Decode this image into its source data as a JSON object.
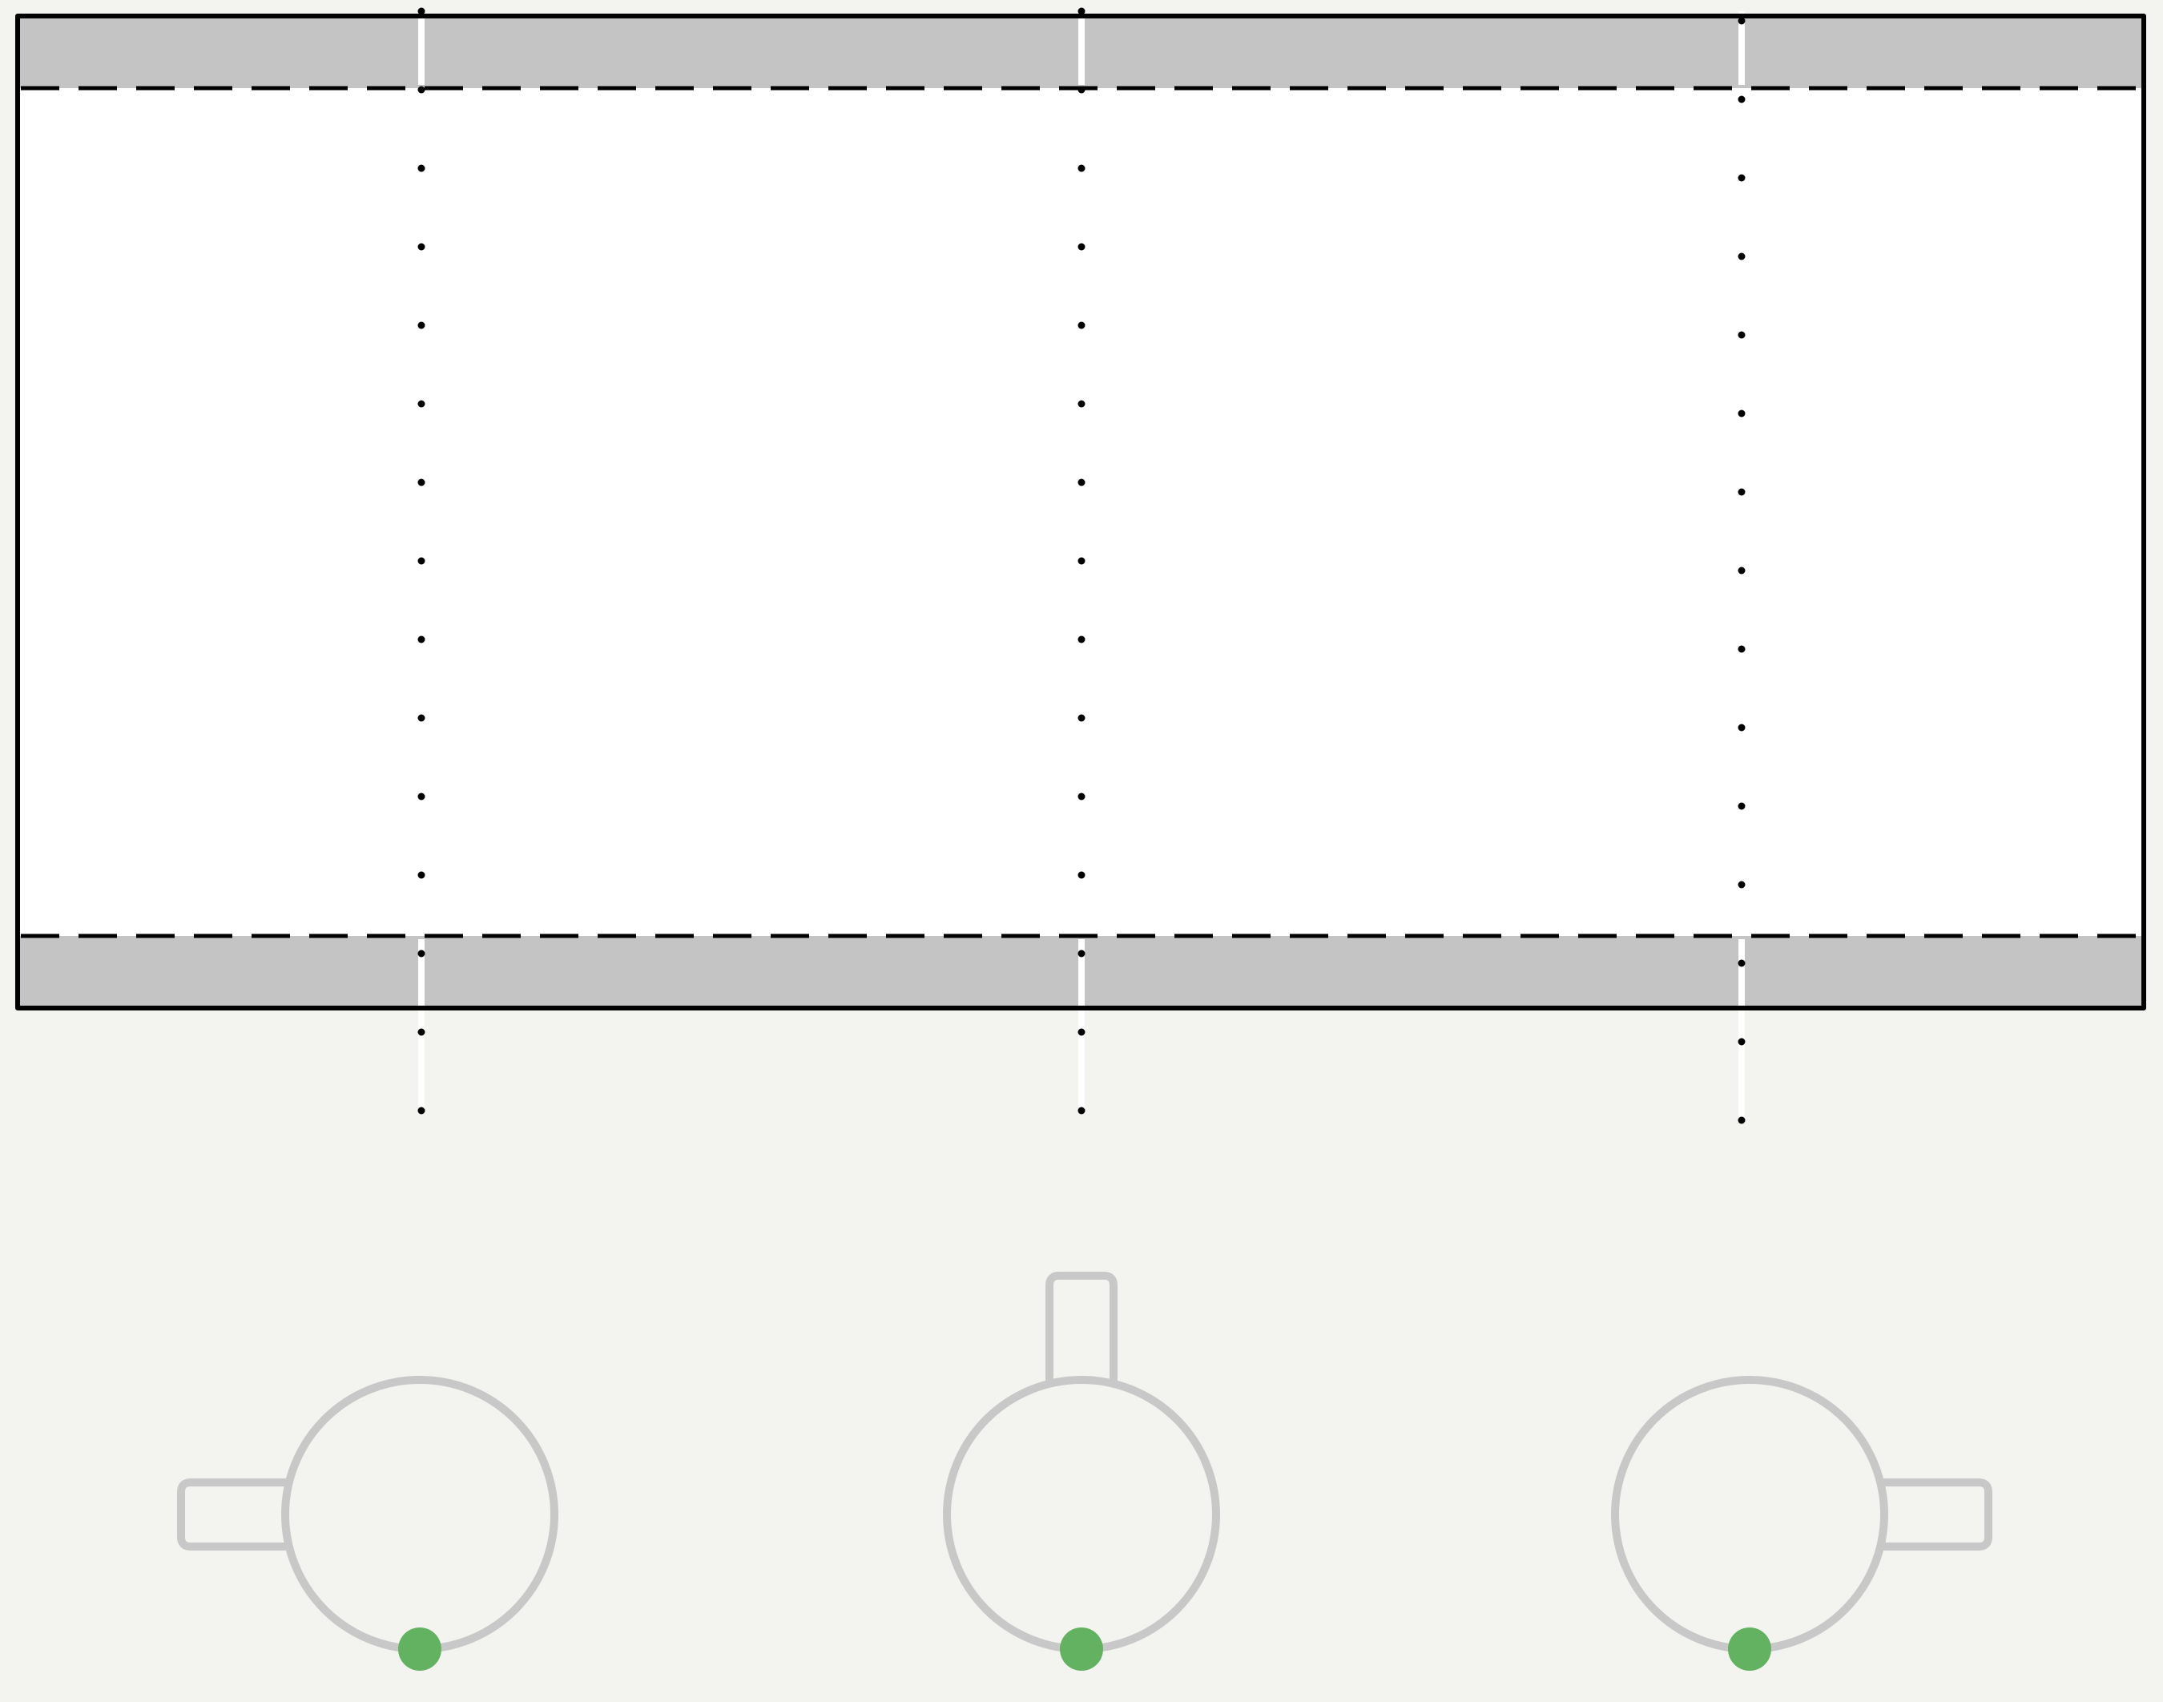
{
  "diagram": {
    "colors": {
      "background": "#f3f4ef",
      "panel_fill": "#ffffff",
      "band_fill": "#c4c4c4",
      "outline": "#000000",
      "divider": "#ffffff",
      "dot": "#000000",
      "knob_outline": "#c8c8c8",
      "indicator": "#62b262"
    },
    "panel": {
      "top_band": true,
      "bottom_band": true,
      "dashed_borders": 2
    },
    "dividers": [
      {
        "id": "left",
        "dot_count": 15
      },
      {
        "id": "center",
        "dot_count": 15
      },
      {
        "id": "right",
        "dot_count": 15
      }
    ],
    "knobs": [
      {
        "id": "left",
        "handle_side": "left",
        "indicator": "bottom"
      },
      {
        "id": "center",
        "handle_side": "top",
        "indicator": "bottom"
      },
      {
        "id": "right",
        "handle_side": "right",
        "indicator": "bottom"
      }
    ]
  }
}
